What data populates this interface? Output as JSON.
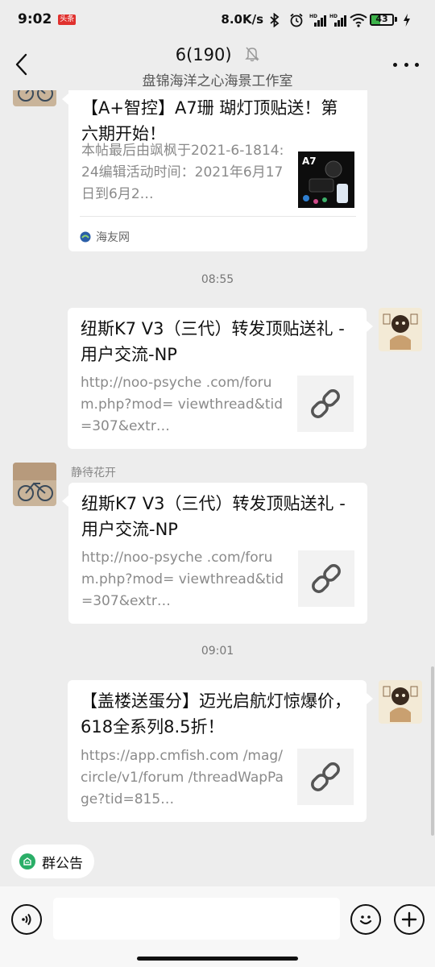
{
  "status_bar": {
    "time": "9:02",
    "app_badge": "头条",
    "network_speed": "8.0K/s",
    "battery": "43",
    "battery_level": 0.43
  },
  "header": {
    "title": "6(190)",
    "subtitle": "盘锦海洋之心海景工作室"
  },
  "messages": [
    {
      "title": "【A+智控】A7珊 瑚灯顶贴送！第六期开始！",
      "description": "本帖最后由飒枫于2021-6-1814:24编辑活动时间：2021年6月17日到6月2…",
      "thumb_label": "A7",
      "source": "海友网"
    },
    {
      "timestamp": "08:55",
      "title": "纽斯K7 V3（三代）转发顶贴送礼 - 用户交流-NP",
      "description": "http://noo-psyche .com/forum.php?mod= viewthread&tid=307&extr…"
    },
    {
      "sender": "静待花开",
      "title": "纽斯K7 V3（三代）转发顶贴送礼 - 用户交流-NP",
      "description": "http://noo-psyche .com/forum.php?mod= viewthread&tid=307&extr…"
    },
    {
      "timestamp": "09:01",
      "title": "【盖楼送蛋分】迈光启航灯惊爆价，618全系列8.5折！",
      "description": "https://app.cmfish.com /mag/circle/v1/forum /threadWapPage?tid=815…"
    }
  ],
  "announcement": {
    "label": "群公告"
  },
  "input": {
    "placeholder": ""
  },
  "colors": {
    "background": "#ededed",
    "card": "#ffffff",
    "accent_green": "#2aae67",
    "battery_green": "#3cb34a",
    "badge_red": "#e0312e"
  }
}
